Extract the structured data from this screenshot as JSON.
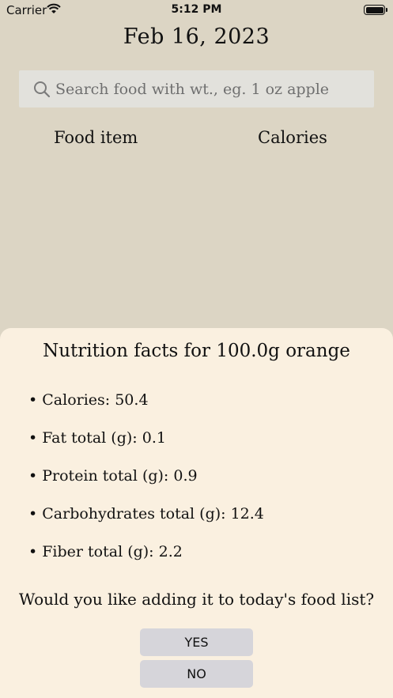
{
  "status_bar": {
    "carrier": "Carrier",
    "time": "5:12 PM"
  },
  "header": {
    "date": "Feb 16, 2023"
  },
  "search": {
    "placeholder": "Search food with wt., eg. 1 oz apple",
    "value": ""
  },
  "table": {
    "columns": [
      "Food item",
      "Calories"
    ]
  },
  "sheet": {
    "title": "Nutrition facts for 100.0g orange",
    "facts": [
      "• Calories: 50.4",
      "• Fat total (g): 0.1",
      "• Protein total (g): 0.9",
      "• Carbohydrates total (g): 12.4",
      "• Fiber total (g): 2.2"
    ],
    "question": "Would you like adding it to today's food list?",
    "yes_label": "YES",
    "no_label": "NO"
  }
}
